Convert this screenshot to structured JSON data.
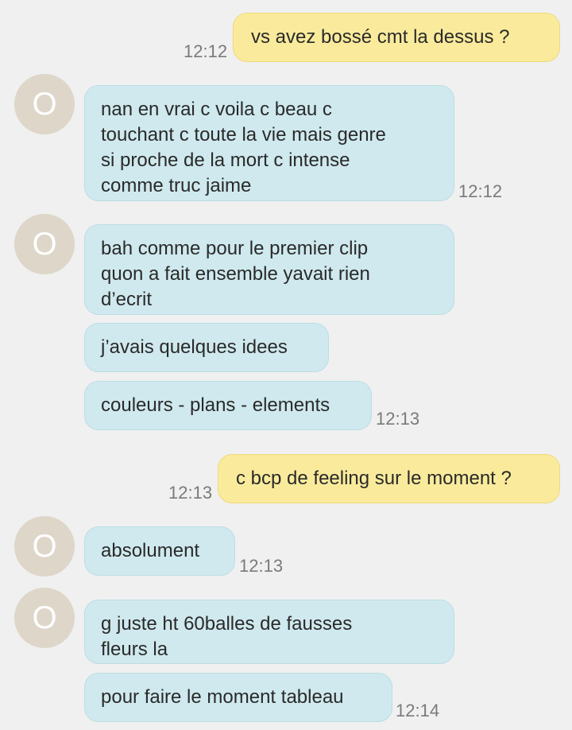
{
  "messages": [
    {
      "direction": "out",
      "lines": [
        "vs avez bossé cmt la dessus ?"
      ],
      "time": "12:12"
    },
    {
      "direction": "in",
      "avatar": "O",
      "lines": [
        "nan en vrai c voila c beau c",
        "touchant c toute la vie mais genre",
        "si proche de la mort c intense",
        "comme truc jaime"
      ],
      "time": "12:12"
    },
    {
      "direction": "in",
      "avatar": "O",
      "lines": [
        "bah comme pour le premier clip",
        "quon a fait ensemble yavait rien",
        "d’ecrit"
      ]
    },
    {
      "direction": "in",
      "lines": [
        "j’avais quelques idees"
      ]
    },
    {
      "direction": "in",
      "lines": [
        "couleurs - plans - elements"
      ],
      "time": "12:13"
    },
    {
      "direction": "out",
      "lines": [
        "c bcp de feeling sur le moment ?"
      ],
      "time": "12:13"
    },
    {
      "direction": "in",
      "avatar": "O",
      "lines": [
        "absolument"
      ],
      "time": "12:13"
    },
    {
      "direction": "in",
      "avatar": "O",
      "lines": [
        "g juste ht 60balles de fausses",
        "fleurs la"
      ]
    },
    {
      "direction": "in",
      "lines": [
        "pour faire le moment tableau"
      ],
      "time": "12:14"
    }
  ]
}
